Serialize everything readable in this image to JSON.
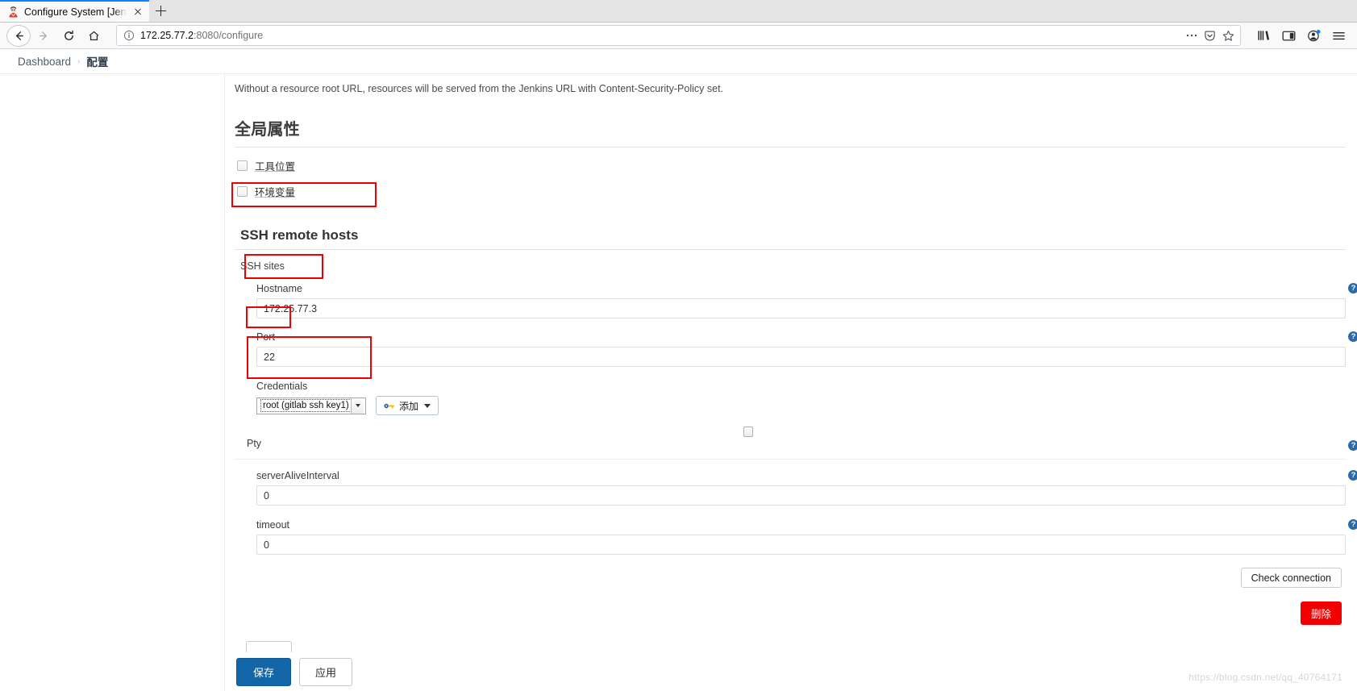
{
  "browser": {
    "tab": {
      "title": "Configure System [Jenkin",
      "favicon_icon": "jenkins-favicon",
      "close_icon": "close-icon"
    },
    "newtab_icon": "plus-icon",
    "nav": {
      "back_icon": "back-arrow-icon",
      "forward_icon": "forward-arrow-icon",
      "reload_icon": "reload-icon",
      "home_icon": "home-icon"
    },
    "urlbar": {
      "info_icon": "info-circle-icon",
      "host": "172.25.77.2",
      "path": ":8080/configure",
      "full_url": "172.25.77.2:8080/configure",
      "page_actions_icon": "ellipsis-icon",
      "reader_icon": "pocket-icon",
      "bookmark_icon": "star-icon"
    },
    "toolbar_right": {
      "library_icon": "library-icon",
      "sidebar_icon": "sidebar-icon",
      "account_icon": "account-icon",
      "menu_icon": "hamburger-menu-icon",
      "account_badge_color": "#0a84ff"
    }
  },
  "jenkins": {
    "breadcrumb": {
      "dashboard": "Dashboard",
      "separator": "›",
      "current": "配置"
    },
    "note": "Without a resource root URL, resources will be served from the Jenkins URL with Content-Security-Policy set.",
    "global_properties": {
      "heading": "全局属性",
      "checkboxes": [
        {
          "label": "工具位置",
          "checked": false
        },
        {
          "label": "环境变量",
          "checked": false
        }
      ]
    },
    "ssh_remote_hosts": {
      "heading": "SSH remote hosts",
      "sites_label": "SSH sites",
      "fields": {
        "hostname": {
          "label": "Hostname",
          "value": "172.25.77.3",
          "help_icon": "help-icon"
        },
        "port": {
          "label": "Port",
          "value": "22",
          "help_icon": "help-icon"
        },
        "credentials": {
          "label": "Credentials",
          "selected": "root (gitlab ssh key1)",
          "dropdown_icon": "chevron-down-icon",
          "add_button": {
            "label": "添加",
            "key_icon": "key-icon",
            "caret_icon": "caret-down-icon"
          }
        },
        "pty": {
          "label": "Pty",
          "checked": false,
          "help_icon": "help-icon"
        },
        "server_alive_interval": {
          "label": "serverAliveInterval",
          "value": "0",
          "help_icon": "help-icon"
        },
        "timeout": {
          "label": "timeout",
          "value": "0",
          "help_icon": "help-icon"
        }
      },
      "check_connection_button": "Check connection",
      "delete_button": "删除",
      "delete_color": "#f00000"
    },
    "footer": {
      "save_button": "保存",
      "apply_button": "应用",
      "save_color": "#1266a8"
    },
    "watermark": "https://blog.csdn.net/qq_40764171"
  }
}
